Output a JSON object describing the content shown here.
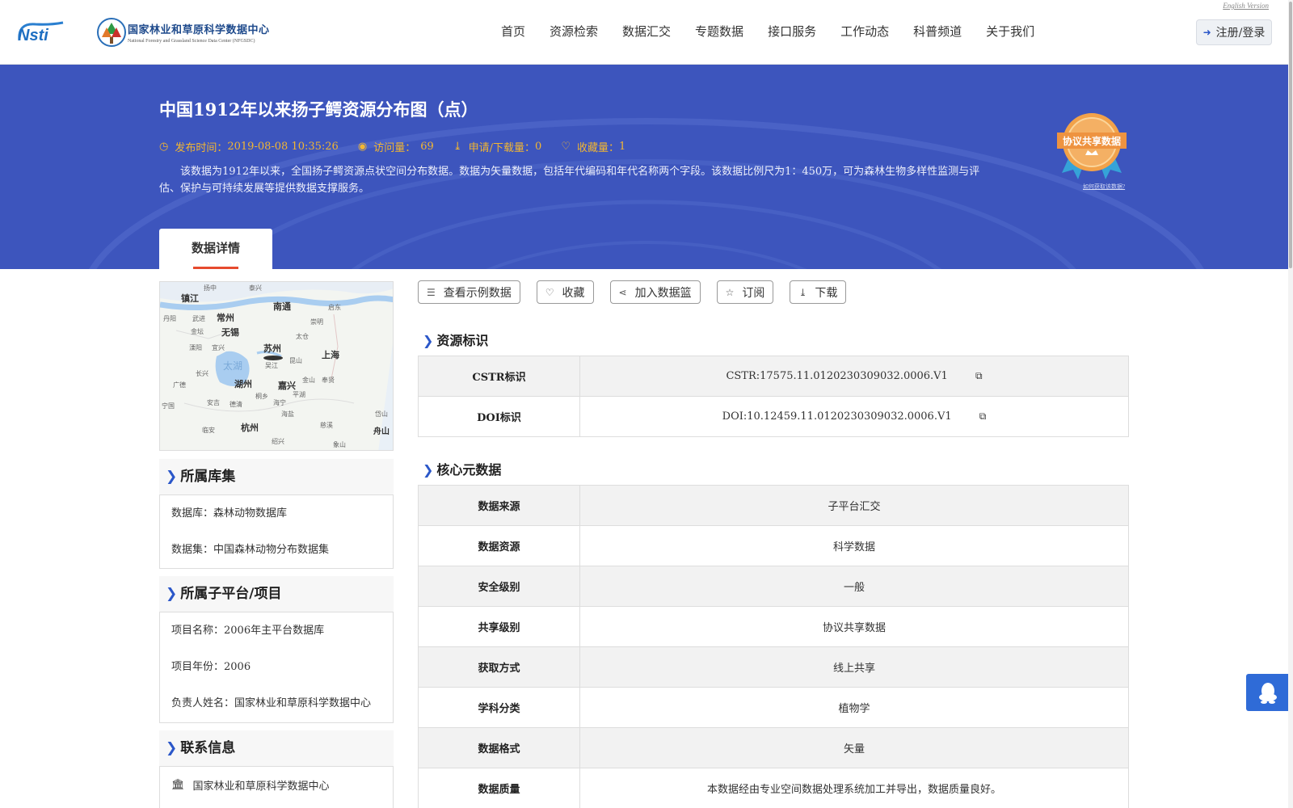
{
  "header": {
    "logo_center_cn": "国家林业和草原科学数据中心",
    "logo_center_en": "National Forestry and Grassland Science Data Center (NFGSDC)",
    "nav": [
      "首页",
      "资源检索",
      "数据汇交",
      "专题数据",
      "接口服务",
      "工作动态",
      "科普频道",
      "关于我们"
    ],
    "english_link": "English Version",
    "login_label": "注册/登录"
  },
  "hero": {
    "title": "中国1912年以来扬子鳄资源分布图（点）",
    "publish_label": "发布时间：",
    "publish_value": "2019-08-08 10:35:26",
    "visits_label": "访问量：",
    "visits_value": "69",
    "downloads_label": "申请/下载量：",
    "downloads_value": "0",
    "favorites_label": "收藏量：",
    "favorites_value": "1",
    "description": "该数据为1912年以来，全国扬子鳄资源点状空间分布数据。数据为矢量数据，包括年代编码和年代名称两个字段。该数据比例尺为1：450万，可为森林生物多样性监测与评估、保护与可持续发展等提供数据支撑服务。",
    "badge_text": "协议共享数据",
    "badge_link": "如何获取该数据?",
    "tab_label": "数据详情"
  },
  "map": {
    "labels": [
      "镇江",
      "常州",
      "无锡",
      "南通",
      "苏州",
      "上海",
      "湖州",
      "嘉兴",
      "杭州",
      "舟山",
      "太湖",
      "扬中",
      "泰兴",
      "启东",
      "崇明",
      "丹阳",
      "武进",
      "金坛",
      "溧阳",
      "宜兴",
      "太仓",
      "昆山",
      "吴江",
      "长兴",
      "广德",
      "安吉",
      "德清",
      "桐乡",
      "海宁",
      "平湖",
      "奉贤",
      "金山",
      "宁国",
      "临安",
      "海盐",
      "岱山",
      "绍兴",
      "慈溪",
      "象山"
    ]
  },
  "left": {
    "collection_title": "所属库集",
    "database_line": "数据库：森林动物数据库",
    "dataset_line": "数据集：中国森林动物分布数据集",
    "platform_title": "所属子平台/项目",
    "project_name_line": "项目名称：2006年主平台数据库",
    "project_year_line": "项目年份：2006",
    "leader_line": "负责人姓名：国家林业和草原科学数据中心",
    "contact_title": "联系信息",
    "contact_org": "国家林业和草原科学数据中心"
  },
  "actions": {
    "sample": "查看示例数据",
    "favorite": "收藏",
    "add_basket": "加入数据篮",
    "subscribe": "订阅",
    "download": "下载"
  },
  "resource_id": {
    "title": "资源标识",
    "rows": [
      {
        "key": "CSTR标识",
        "value": "CSTR:17575.11.0120230309032.0006.V1"
      },
      {
        "key": "DOI标识",
        "value": "DOI:10.12459.11.0120230309032.0006.V1"
      }
    ]
  },
  "core_meta": {
    "title": "核心元数据",
    "rows": [
      {
        "key": "数据来源",
        "value": "子平台汇交"
      },
      {
        "key": "数据资源",
        "value": "科学数据"
      },
      {
        "key": "安全级别",
        "value": "一般"
      },
      {
        "key": "共享级别",
        "value": "协议共享数据"
      },
      {
        "key": "获取方式",
        "value": "线上共享"
      },
      {
        "key": "学科分类",
        "value": "植物学"
      },
      {
        "key": "数据格式",
        "value": "矢量"
      },
      {
        "key": "数据质量",
        "value": "本数据经由专业空间数据处理系统加工并导出，数据质量良好。"
      }
    ]
  },
  "colors": {
    "hero_bg": "#3d55bd",
    "meta_accent": "#f2b632",
    "tab_underline": "#e64a2e",
    "chevron": "#2b57c9",
    "qq_widget": "#2f6bd7"
  },
  "icons": [
    "clock-icon",
    "eye-icon",
    "download-icon",
    "heart-icon",
    "database-icon",
    "share-icon",
    "star-icon",
    "copy-icon",
    "bank-icon",
    "login-icon",
    "qq-penguin-icon",
    "chevron-right-icon"
  ]
}
